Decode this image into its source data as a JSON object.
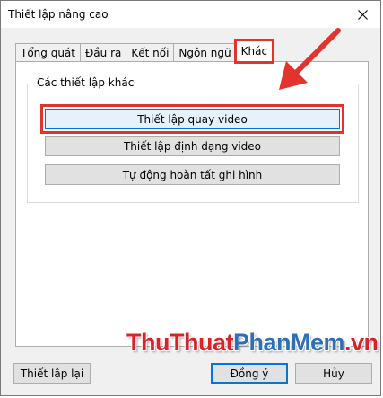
{
  "window": {
    "title": "Thiết lập nâng cao"
  },
  "tabs": [
    {
      "label": "Tổng quát",
      "active": false
    },
    {
      "label": "Đầu ra",
      "active": false
    },
    {
      "label": "Kết nối",
      "active": false
    },
    {
      "label": "Ngôn ngữ",
      "active": false
    },
    {
      "label": "Khác",
      "active": true
    }
  ],
  "group": {
    "legend": "Các thiết lập khác",
    "buttons": [
      {
        "label": "Thiết lập quay video",
        "highlighted": true
      },
      {
        "label": "Thiết lập định dạng video",
        "highlighted": false
      },
      {
        "label": "Tự động hoàn tất ghi hình",
        "highlighted": false
      }
    ]
  },
  "footer": {
    "reset_label": "Thiết lập lại",
    "ok_label": "Đồng ý",
    "cancel_label": "Hủy"
  },
  "watermark": {
    "part1": "Thu",
    "part2": "Thuat",
    "part3": "PhanMem",
    "part4": ".vn"
  },
  "colors": {
    "highlight_red": "#e2332c",
    "accent_blue": "#0078d7"
  },
  "icons": {
    "close": "close-icon",
    "annotation_arrow": "arrow-icon"
  }
}
